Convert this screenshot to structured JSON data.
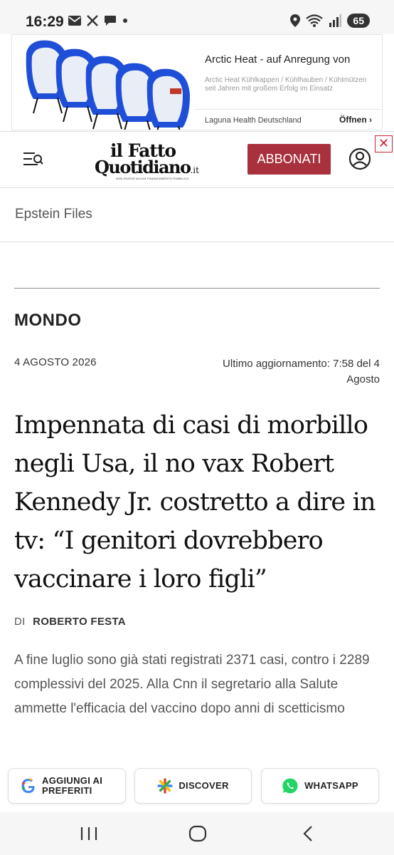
{
  "status_bar": {
    "time": "16:29",
    "battery": "65",
    "icons": [
      "mail-icon",
      "x-icon",
      "chat-icon",
      "dot-icon",
      "location-icon",
      "wifi-icon",
      "signal-icon",
      "battery-icon"
    ]
  },
  "ad": {
    "title": "Arctic Heat - auf Anregung von",
    "description": "Arctic Heat Kühlkappen / Kühlhauben / Kühlmützen seit Jahren mit großem Erfolg im Einsatz",
    "advertiser": "Laguna Health Deutschland",
    "open_label": "Öffnen",
    "close_label": "✕"
  },
  "header": {
    "logo_line1": "il Fatto",
    "logo_line2": "Quotidiano",
    "logo_suffix": ".it",
    "logo_tagline": "NON RICEVE ALCUN FINANZIAMENTO PUBBLICO",
    "subscribe_label": "ABBONATI",
    "accent_color": "#a8313d"
  },
  "topic": "Epstein Files",
  "article": {
    "section": "MONDO",
    "date": "4 AGOSTO 2026",
    "updated": "Ultimo aggiornamento: 7:58 del 4 Agosto",
    "headline": "Impennata di casi di morbillo negli Usa, il no vax Robert Kennedy Jr. costretto a dire in tv: “I genitori dovrebbero vaccinare i loro figli”",
    "byline_prefix": "DI",
    "author": "ROBERTO FESTA",
    "lead": "A fine luglio sono già stati registrati 2371 casi, contro i 2289 complessivi del 2025. Alla Cnn il segretario alla Salute ammette l'efficacia del vaccino dopo anni di scetticismo"
  },
  "actions": [
    {
      "label": "AGGIUNGI AI PREFERITI",
      "icon": "google-icon"
    },
    {
      "label": "DISCOVER",
      "icon": "discover-icon"
    },
    {
      "label": "WHATSAPP",
      "icon": "whatsapp-icon"
    }
  ],
  "navigation": [
    "recent-apps-icon",
    "home-icon",
    "back-icon"
  ]
}
